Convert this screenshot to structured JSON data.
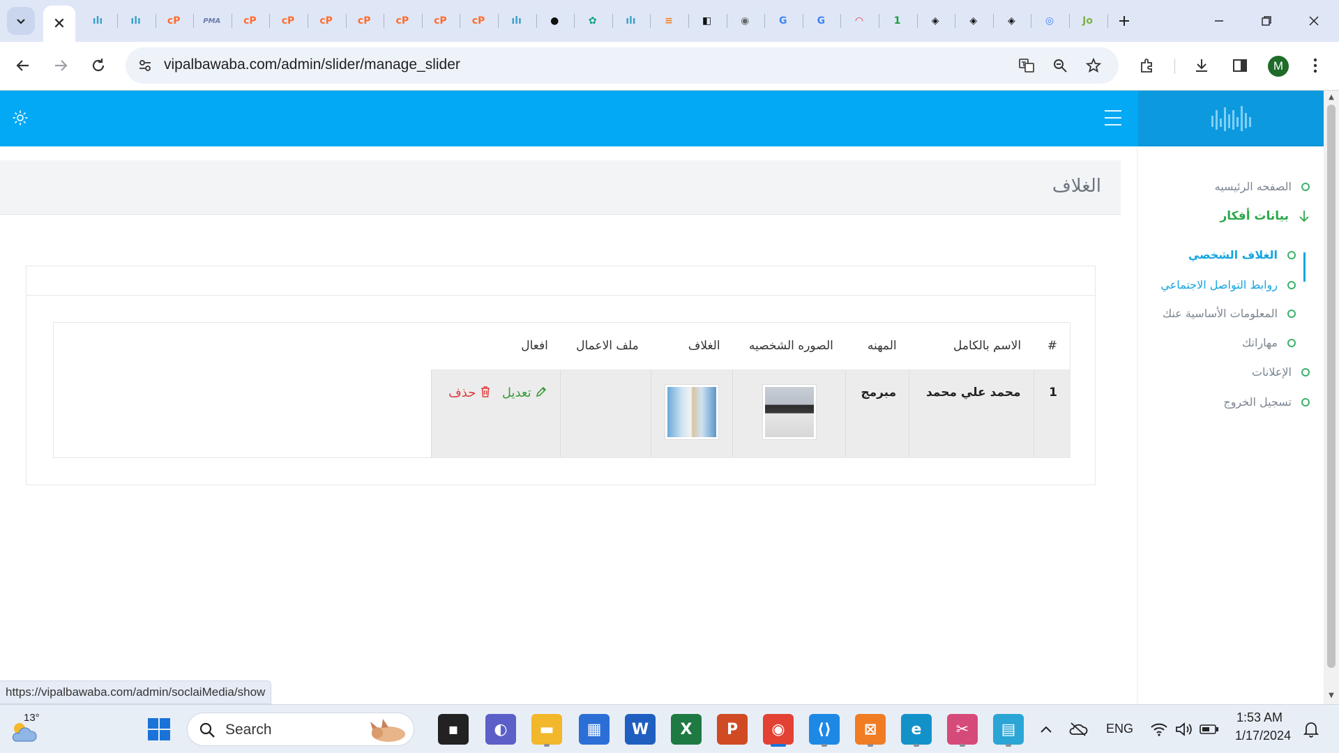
{
  "browser": {
    "active_tab_close": "✕",
    "tab_favicons": [
      "vipalbawaba-icon",
      "vipalbawaba-icon",
      "cpanel-icon",
      "phpmyadmin-icon",
      "cpanel-icon",
      "cpanel-icon",
      "cpanel-icon",
      "cpanel-icon",
      "cpanel-icon",
      "cpanel-icon",
      "cpanel-icon",
      "vipalbawaba-icon",
      "github-icon",
      "chatgpt-icon",
      "vipalbawaba-icon",
      "stackoverflow-icon",
      "capcut-icon",
      "globe-icon",
      "google-icon",
      "google-icon",
      "speedtest-icon",
      "onepass-icon",
      "codepen-icon",
      "codepen-icon",
      "codepen-icon",
      "google-lens-icon",
      "jo-icon"
    ],
    "pma_label": "PMA",
    "url": "vipalbawaba.com/admin/slider/manage_slider",
    "profile_initial": "M",
    "status_url": "https://vipalbawaba.com/admin/soclaiMedia/show"
  },
  "sidebar": {
    "home": "الصفحه الرئيسيه",
    "group": "بيانات أفكار",
    "items": [
      {
        "label": "الغلاف الشخصي"
      },
      {
        "label": "روابط التواصل الاجتماعي"
      },
      {
        "label": "المعلومات الأساسية عنك"
      },
      {
        "label": "مهاراتك"
      }
    ],
    "ads": "الإعلانات",
    "logout": "تسجيل الخروج"
  },
  "page": {
    "title": "الغلاف"
  },
  "table": {
    "headers": [
      "#",
      "الاسم بالكامل",
      "المهنه",
      "الصوره الشخصيه",
      "الغلاف",
      "ملف الاعمال",
      "افعال"
    ],
    "rows": [
      {
        "index": "1",
        "full_name": "محمد علي محمد",
        "profession": "مبرمج",
        "portfolio": "",
        "edit_label": "تعديل",
        "delete_label": "حذف"
      }
    ]
  },
  "taskbar": {
    "temperature": "13°",
    "search_label": "Search",
    "language": "ENG",
    "time": "1:53 AM",
    "date": "1/17/2024"
  },
  "colors": {
    "topbar": "#03a9f4",
    "sidebar_group": "#2aa84a",
    "link": "#15a6df",
    "edit": "#3a9d3a",
    "delete": "#e03b3b"
  }
}
